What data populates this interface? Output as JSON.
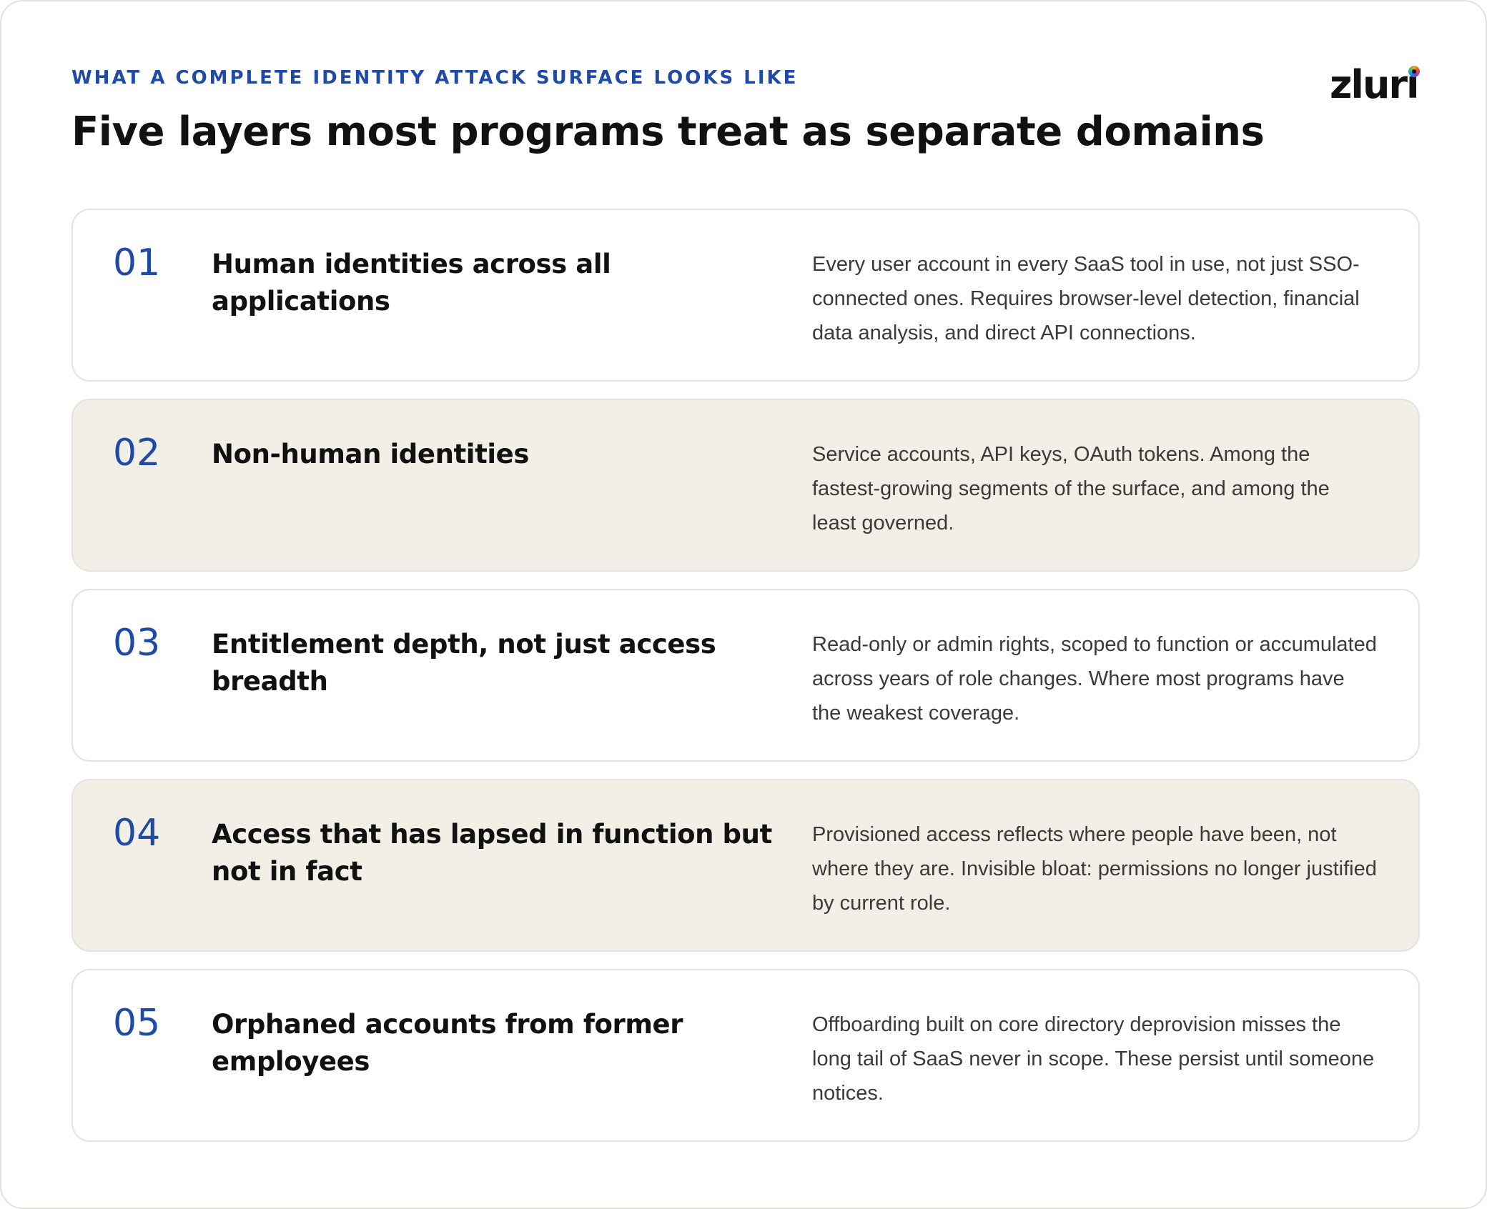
{
  "header": {
    "eyebrow": "WHAT A COMPLETE IDENTITY ATTACK SURFACE LOOKS LIKE",
    "title": "Five layers most programs treat as separate domains"
  },
  "logo": {
    "text": "zluri",
    "icon": "zluri-logo-dot"
  },
  "colors": {
    "accent": "#1f4aa6",
    "shaded_row": "#f2efe7",
    "border": "#e4e2dc"
  },
  "layers": [
    {
      "number": "01",
      "title": "Human identities across all applications",
      "description": "Every user account in every SaaS tool in use, not just SSO-connected ones. Requires browser-level detection, financial data analysis, and direct API connections."
    },
    {
      "number": "02",
      "title": "Non-human identities",
      "description": "Service accounts, API keys, OAuth tokens. Among the fastest-growing segments of the surface, and among the least governed."
    },
    {
      "number": "03",
      "title": "Entitlement depth, not just access breadth",
      "description": "Read-only or admin rights, scoped to function or accumulated across years of role changes. Where most programs have the weakest coverage."
    },
    {
      "number": "04",
      "title": "Access that has lapsed in function but not in fact",
      "description": "Provisioned access reflects where people have been, not where they are. Invisible bloat: permissions no longer justified by current role."
    },
    {
      "number": "05",
      "title": "Orphaned accounts from former employees",
      "description": "Offboarding built on core directory deprovision misses the long tail of SaaS never in scope. These persist until someone notices."
    }
  ]
}
